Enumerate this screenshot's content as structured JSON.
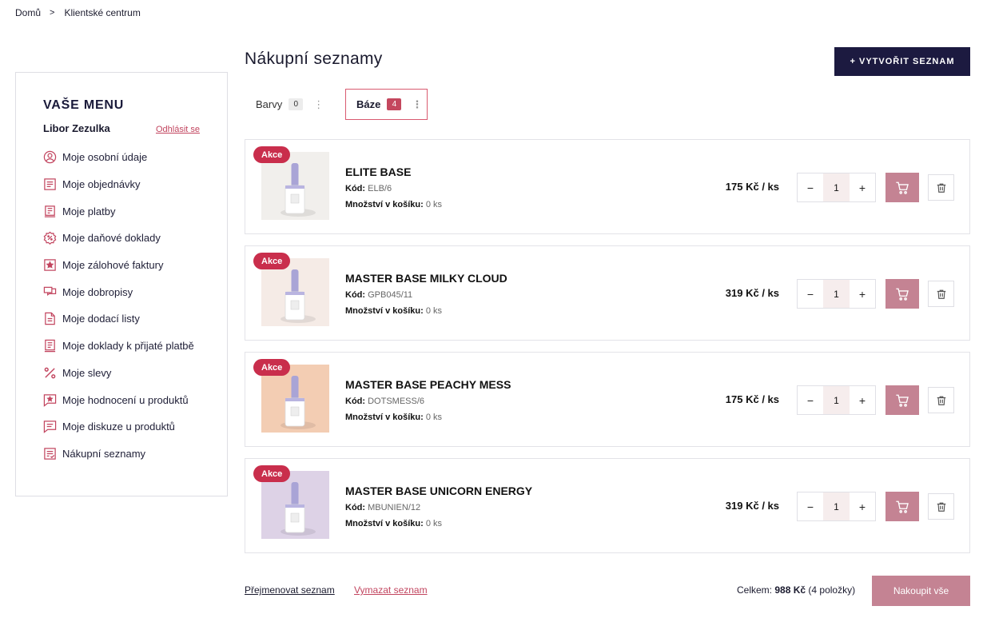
{
  "breadcrumb": {
    "home": "Domů",
    "separator": ">",
    "current": "Klientské centrum"
  },
  "menu": {
    "title": "VAŠE MENU",
    "user_name": "Libor Zezulka",
    "logout": "Odhlásit se",
    "items": [
      {
        "label": "Moje osobní údaje",
        "icon": "user-circle-icon"
      },
      {
        "label": "Moje objednávky",
        "icon": "orders-icon"
      },
      {
        "label": "Moje platby",
        "icon": "payments-icon"
      },
      {
        "label": "Moje daňové doklady",
        "icon": "tax-docs-icon"
      },
      {
        "label": "Moje zálohové faktury",
        "icon": "star-invoice-icon"
      },
      {
        "label": "Moje dobropisy",
        "icon": "credit-note-icon"
      },
      {
        "label": "Moje dodací listy",
        "icon": "delivery-note-icon"
      },
      {
        "label": "Moje doklady k přijaté platbě",
        "icon": "receipt-icon"
      },
      {
        "label": "Moje slevy",
        "icon": "percent-icon"
      },
      {
        "label": "Moje hodnocení u produktů",
        "icon": "rating-icon"
      },
      {
        "label": "Moje diskuze u produktů",
        "icon": "discussion-icon"
      },
      {
        "label": "Nákupní seznamy",
        "icon": "shopping-list-icon"
      }
    ]
  },
  "page": {
    "title": "Nákupní seznamy",
    "create_button": "+ VYTVOŘIT SEZNAM"
  },
  "tabs": [
    {
      "label": "Barvy",
      "count": "0",
      "menu": "⋮"
    },
    {
      "label": "Báze",
      "count": "4",
      "menu": "⋮"
    }
  ],
  "colors": {
    "accent": "#c92e4c",
    "dark": "#1c1a40",
    "muted_pink": "#c48393"
  },
  "labels": {
    "badge": "Akce",
    "code": "Kód:",
    "in_cart": "Množství v košíku:"
  },
  "products": [
    {
      "name": "ELITE BASE",
      "code": "ELB/6",
      "in_cart": "0 ks",
      "price": "175 Kč / ks",
      "qty": "1",
      "thumb_bg": "#f1efec"
    },
    {
      "name": "MASTER BASE MILKY CLOUD",
      "code": "GPB045/11",
      "in_cart": "0 ks",
      "price": "319 Kč / ks",
      "qty": "1",
      "thumb_bg": "#f5ebe6"
    },
    {
      "name": "MASTER BASE PEACHY MESS",
      "code": "DOTSMESS/6",
      "in_cart": "0 ks",
      "price": "175 Kč / ks",
      "qty": "1",
      "thumb_bg": "#f3cdb3"
    },
    {
      "name": "MASTER BASE UNICORN ENERGY",
      "code": "MBUNIEN/12",
      "in_cart": "0 ks",
      "price": "319 Kč / ks",
      "qty": "1",
      "thumb_bg": "#ddd2e6"
    }
  ],
  "stepper": {
    "minus": "−",
    "plus": "+"
  },
  "footer": {
    "rename": "Přejmenovat seznam",
    "clear": "Vymazat seznam",
    "total_label": "Celkem:",
    "total_value": "988 Kč",
    "total_count": "(4 položky)",
    "buy_all": "Nakoupit vše"
  }
}
